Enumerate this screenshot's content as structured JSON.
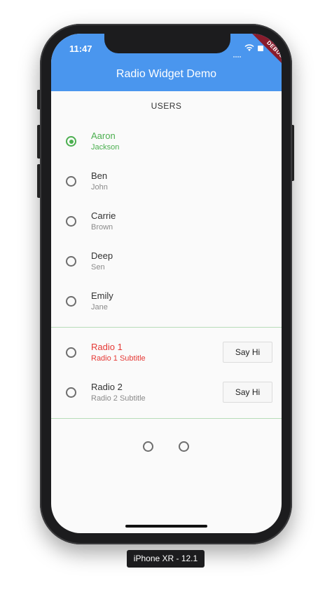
{
  "status_bar": {
    "time": "11:47"
  },
  "app_bar": {
    "title": "Radio Widget Demo",
    "debug_banner": "DEBUG",
    "color": "#4a96ee"
  },
  "list": {
    "header": "USERS",
    "users": [
      {
        "first": "Aaron",
        "last": "Jackson",
        "selected": true
      },
      {
        "first": "Ben",
        "last": "John",
        "selected": false
      },
      {
        "first": "Carrie",
        "last": "Brown",
        "selected": false
      },
      {
        "first": "Deep",
        "last": "Sen",
        "selected": false
      },
      {
        "first": "Emily",
        "last": "Jane",
        "selected": false
      }
    ]
  },
  "radio_tiles": [
    {
      "title": "Radio 1",
      "subtitle": "Radio 1 Subtitle",
      "button": "Say Hi",
      "color": "#e53935"
    },
    {
      "title": "Radio 2",
      "subtitle": "Radio 2 Subtitle",
      "button": "Say Hi"
    }
  ],
  "device": {
    "label": "iPhone XR - 12.1"
  },
  "colors": {
    "selected": "#4caf50",
    "error": "#e53935",
    "divider": "#b7dcb8"
  }
}
